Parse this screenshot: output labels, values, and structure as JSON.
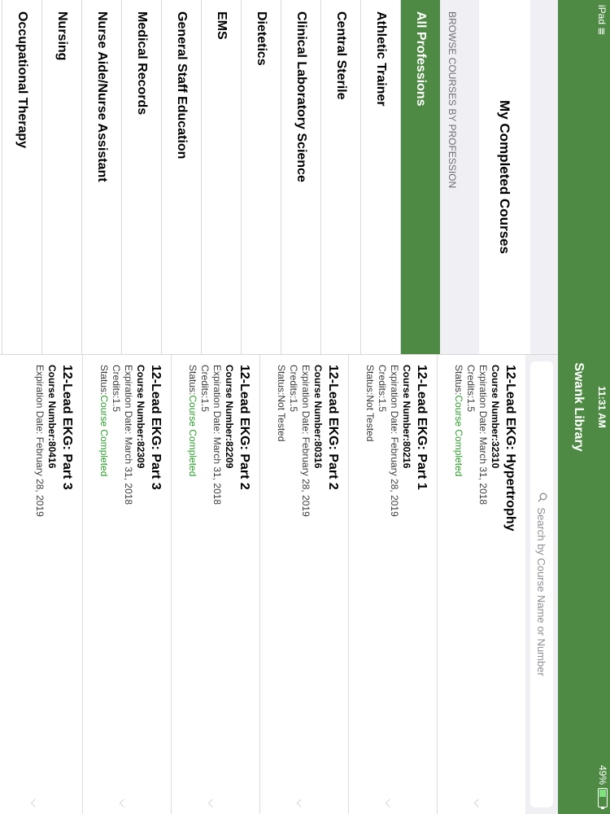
{
  "status_bar": {
    "device": "iPad",
    "time": "11:31 AM",
    "battery": "49%",
    "battery_level": 0.49
  },
  "nav": {
    "title": "Swank Library"
  },
  "sidebar": {
    "completed_label": "My Completed Courses",
    "browse_header": "BROWSE COURSES BY PROFESSION",
    "professions": [
      "All Professions",
      "Athletic Trainer",
      "Central Sterile",
      "Clinical Laboratory Science",
      "Dietetics",
      "EMS",
      "General Staff Education",
      "Medical Records",
      "Nurse Aide/Nurse Assistant",
      "Nursing",
      "Occupational Therapy"
    ],
    "selected": "All Professions"
  },
  "search": {
    "placeholder": "Search by Course Name or Number"
  },
  "courses": [
    {
      "title": "12-Lead EKG: Hypertrophy",
      "number": "Course Number:32310",
      "expiration": "Expiration Date: March 31, 2018",
      "credits": "Credits:1.5",
      "status_label": "Status:",
      "status_value": "Course Completed",
      "completed": true
    },
    {
      "title": "12-Lead EKG: Part 1",
      "number": "Course Number:80216",
      "expiration": "Expiration Date: February 28, 2019",
      "credits": "Credits:1.5",
      "status_label": "Status:",
      "status_value": "Not Tested",
      "completed": false
    },
    {
      "title": "12-Lead EKG: Part 2",
      "number": "Course Number:80316",
      "expiration": "Expiration Date: February 28, 2019",
      "credits": "Credits:1.5",
      "status_label": "Status:",
      "status_value": "Not Tested",
      "completed": false
    },
    {
      "title": "12-Lead EKG: Part 2",
      "number": "Course Number:82209",
      "expiration": "Expiration Date: March 31, 2018",
      "credits": "Credits:1.5",
      "status_label": "Status:",
      "status_value": "Course Completed",
      "completed": true
    },
    {
      "title": "12-Lead EKG: Part 3",
      "number": "Course Number:82309",
      "expiration": "Expiration Date: March 31, 2018",
      "credits": "Credits:1.5",
      "status_label": "Status:",
      "status_value": "Course Completed",
      "completed": true
    },
    {
      "title": "12-Lead EKG: Part 3",
      "number": "Course Number:80416",
      "expiration": "Expiration Date: February 28, 2019",
      "credits": "",
      "status_label": "",
      "status_value": "",
      "completed": false
    }
  ],
  "colors": {
    "brand_green": "#4f8a44",
    "status_green": "#2e9a2e"
  }
}
